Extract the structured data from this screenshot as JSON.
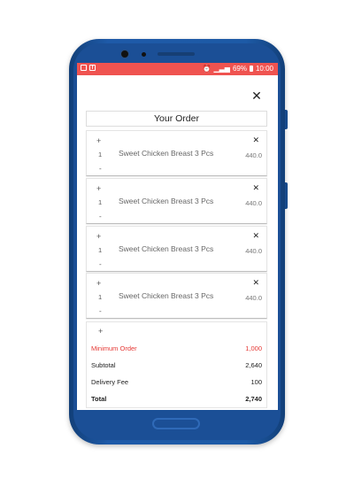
{
  "statusbar": {
    "battery": "69%",
    "time": "10:00"
  },
  "order": {
    "title": "Your Order",
    "items": [
      {
        "name": "Sweet Chicken Breast 3 Pcs",
        "qty": "1",
        "price": "440.0"
      },
      {
        "name": "Sweet Chicken Breast 3 Pcs",
        "qty": "1",
        "price": "440.0"
      },
      {
        "name": "Sweet Chicken Breast 3 Pcs",
        "qty": "1",
        "price": "440.0"
      },
      {
        "name": "Sweet Chicken Breast 3 Pcs",
        "qty": "1",
        "price": "440.0"
      }
    ]
  },
  "summary": {
    "minimum_label": "Minimum Order",
    "minimum_value": "1,000",
    "subtotal_label": "Subtotal",
    "subtotal_value": "2,640",
    "delivery_label": "Delivery Fee",
    "delivery_value": "100",
    "total_label": "Total",
    "total_value": "2,740"
  },
  "symbols": {
    "plus": "+",
    "minus": "-",
    "close": "✕",
    "remove": "✕"
  },
  "colors": {
    "statusbar": "#ef5350",
    "minimum": "#e53935",
    "phone_body": "#1e5aa8"
  }
}
